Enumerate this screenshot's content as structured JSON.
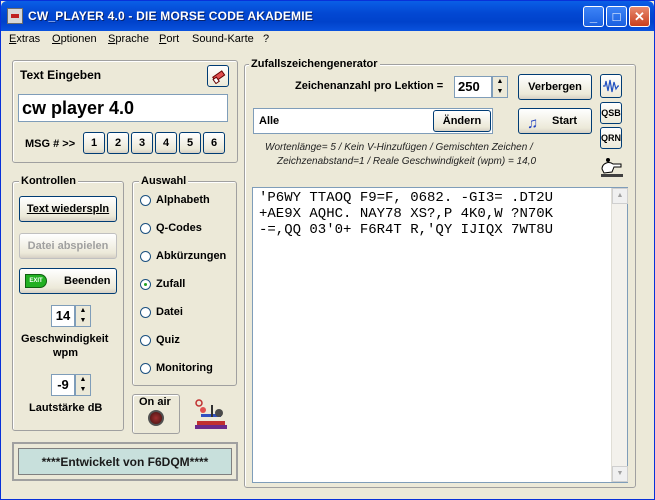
{
  "window": {
    "title": "CW_PLAYER 4.0 - DIE MORSE CODE AKADEMIE"
  },
  "menu": [
    {
      "label": "Extras",
      "ul": "E",
      "rest": "xtras"
    },
    {
      "label": "Optionen",
      "ul": "O",
      "rest": "ptionen"
    },
    {
      "label": "Sprache",
      "ul": "S",
      "rest": "prache"
    },
    {
      "label": "Port",
      "ul": "P",
      "rest": "ort"
    },
    {
      "label": "Sound-Karte",
      "ul": "",
      "rest": "Sound-Karte"
    },
    {
      "label": "?",
      "ul": "",
      "rest": "?"
    }
  ],
  "text_panel": {
    "title": "Text Eingeben",
    "input_value": "cw player 4.0",
    "msg_label": "MSG # >>",
    "msg_buttons": [
      "1",
      "2",
      "3",
      "4",
      "5",
      "6"
    ]
  },
  "kontrollen": {
    "title": "Kontrollen",
    "replay_label": "Text wiederspln",
    "play_file_label": "Datei abspielen",
    "exit_label": "Beenden",
    "exit_icon_text": "EXIT",
    "speed_value": "14",
    "speed_label": "Geschwindigkeit",
    "speed_unit": "wpm",
    "volume_value": "-9",
    "volume_label": "Lautstärke dB"
  },
  "auswahl": {
    "title": "Auswahl",
    "options": [
      "Alphabeth",
      "Q-Codes",
      "Abkürzungen",
      "Zufall",
      "Datei",
      "Quiz",
      "Monitoring"
    ],
    "selected_index": 3
  },
  "on_air": {
    "label": "On air"
  },
  "footer": {
    "text": "****Entwickelt von F6DQM****"
  },
  "generator": {
    "title": "Zufallszeichengenerator",
    "count_label": "Zeichenanzahl pro Lektion =",
    "count_value": "250",
    "hide_label": "Verbergen",
    "set_value": "Alle",
    "change_label": "Ändern",
    "start_label": "Start",
    "info_line1": "Wortenlänge= 5 / Kein V-Hinzufügen / Gemischten Zeichen /",
    "info_line2": "Zeichzenabstand=1 / Reale Geschwindigkeit (wpm) = 14,0",
    "icons": [
      "QSB",
      "QRN"
    ],
    "output_lines": [
      "'P6WY TTAOQ F9=F, 0682. -GI3= .DT2U",
      "+AE9X AQHC. NAY78 XS?,P 4K0,W ?N70K",
      "-=,QQ 03'0+ F6R4T R,'QY IJIQX 7WT8U"
    ]
  },
  "colors": {
    "title_bar": "#0042cb",
    "window_bg": "#ece9d8",
    "footer_bg": "#c8e0dc"
  }
}
